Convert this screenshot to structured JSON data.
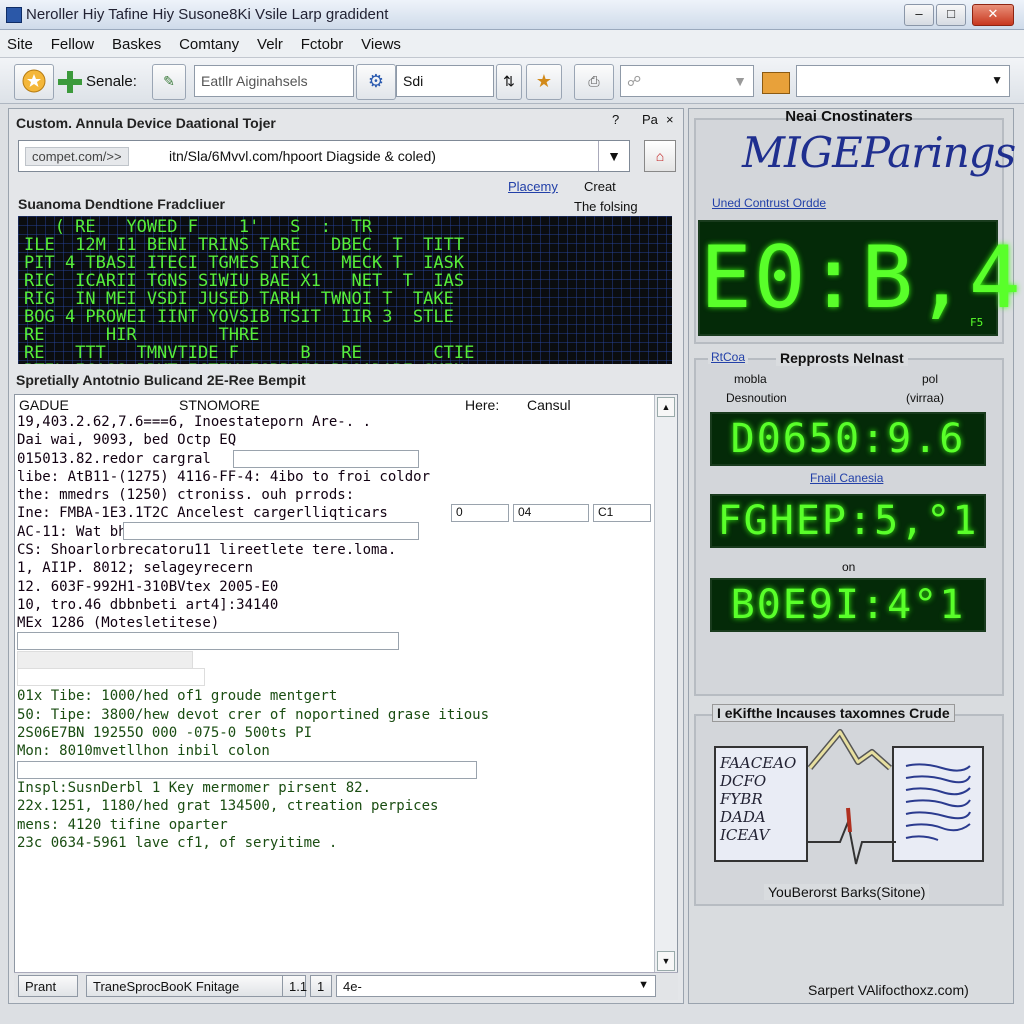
{
  "window": {
    "title": "Neroller Hiy Tafine Hiy Susone8Ki Vsile Larp gradident"
  },
  "menu": [
    "Site",
    "Fellow",
    "Baskes",
    "Comtany",
    "Velr",
    "Fctobr",
    "Views"
  ],
  "toolbar": {
    "send_label": "Senale:",
    "address_placeholder": "Eatllr Aiginahsels",
    "sdi_label": "Sdi"
  },
  "left": {
    "header": "Custom. Annula Device Daational Tojer",
    "header_btn1": "?",
    "header_btn2": "Pa",
    "url_prefix": "compet.com/>>",
    "url_text": "itn/Sla/6Mvvl.com/hpoort Diagside & coled)",
    "sublinks": {
      "link": "Placemy",
      "create": "Creat",
      "fold": "The folsing"
    },
    "matrix_title": "Suanoma Dendtione Fradcliuer",
    "matrix_lines": [
      "   ( RE   YOWED F    1'   S  :  TR  ",
      "ILE  12M I1 BENI TRINS TARE   DBEC  T  TITT",
      "PIT 4 TBASI ITECI TGMES IRIC   MECK T  IASK",
      "RIC  ICARII TGNS SIWIU BAE X1   NET  T  IAS",
      "RIG  IN MEI VSDI JUSED TARH  TWNOI T  TAKE",
      "BOG 4 PROWEI IINT YOVSIB TSIT  IIR 3  STLE",
      "RE      HIR        THRE                     ",
      "RE   TTT   TMNVTIDE F      B   RE       CTIE",
      "BTIL ICASS BRKT ICTEY EGBRIES BROADABE SMIN"
    ],
    "log_title": "Spretially Antotnio Bulicand 2E-Ree Bempit",
    "log_header": {
      "col1": "GADUE",
      "col2": "STNOMORE",
      "col3": "Here:",
      "col4": "Cansul"
    },
    "log_lines": [
      "19,403.2.62,7.6===6, Inoestateporn Are-. .",
      "Dai wai, 9093, bed Octp EQ",
      "015013.82.redor cargral",
      "libe: AtB11-(1275) 4116-FF-4: 4ibo to froi coldor",
      "the: mmedrs (1250) ctroniss. ouh prrods:",
      "Ine: FMBA-1E3.1T2C Ancelest cargerlliqticars",
      "AC-11: Wat bhed=",
      "CS: Shoarlorbrecatoru11 lireetlete tere.loma.",
      "1, AI1P. 8012; selageyrecern",
      "12. 603F-992H1-310BVtex 2005-E0",
      "10, tro.46 dbbnbeti art4]:34140",
      "MEx 1286 (Motesletitese)",
      "",
      "",
      "",
      "01x Tibe: 1000/hed of1 groude mentgert",
      "50: Tipe: 3800/hew devot crer of noportined grase itious",
      "2S06E7BN 19255O 000 -075-0 500ts PI",
      "Mon: 8010mvetllhon inbil colon",
      "",
      "Inspl:SusnDerbl 1 Key mermomer pirsent 82.",
      "22x.1251, 1180/hed grat 134500, ctreation perpices",
      "mens: 4120 tifine oparter",
      "23c 0634-5961 lave cf1, of seryitime ."
    ],
    "field_values": {
      "f1": "0",
      "f2": "04",
      "f3": "C1"
    },
    "status": {
      "print": "Prant",
      "status_text": "TraneSprocBooK Fnitage",
      "s1": "1.1",
      "s2": "1",
      "s3": "4e-"
    }
  },
  "right": {
    "panel1_title": "Neai Cnostinaters",
    "brand": "MIGEParings",
    "panel1_link": "Uned Contrust Ordde",
    "lcd_main": "E0:B,4",
    "lcd_main_tag": "F5",
    "panel2_link": "RtCoa",
    "panel2_title": "Repprosts Nelnast",
    "panel2_col1a": "mobla",
    "panel2_col1b": "Desnoution",
    "panel2_col2a": "pol",
    "panel2_col2b": "(virraa)",
    "lcd1": "D0650:9.6",
    "lcd1_link": "Fnail Canesia",
    "lcd2": "FGHEP:5,°1",
    "lcd_sep": "on",
    "lcd3": "B0E9I:4°1",
    "panel3_title": "I eKifthe Incauses taxomnes Crude",
    "doc_lines": [
      "FAACEAO",
      "DCFO",
      "FYBR",
      "DADA",
      "ICEAV"
    ],
    "panel3_footer": "YouBerorst Barks(Sitone)",
    "footer": "Sarpert VAlifocthoxz.com)"
  },
  "colors": {
    "lcd_green": "#59ff2a",
    "matrix_green": "#57ee3a",
    "brand_blue": "#1f2f8f"
  }
}
